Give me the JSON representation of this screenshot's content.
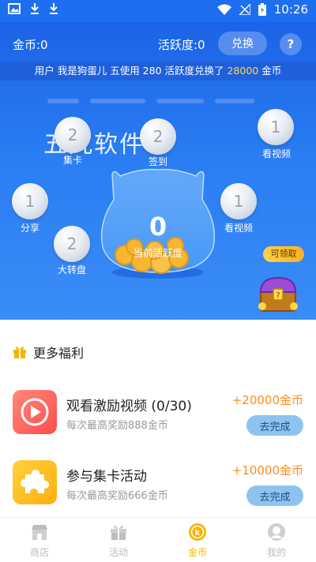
{
  "statusbar": {
    "time": "10:26"
  },
  "header": {
    "coin_label": "金币:0",
    "activity_label": "活跃度:0",
    "exchange_label": "兑换",
    "help_label": "?"
  },
  "ticker": {
    "prefix": "用户 我是狗蛋儿 五使用 280 活跃度兑换了 ",
    "amount": "28000",
    "suffix": " 金币"
  },
  "watermark": "五九软件",
  "bubbles": [
    {
      "value": "2",
      "label": "集卡"
    },
    {
      "value": "2",
      "label": "签到"
    },
    {
      "value": "1",
      "label": "看视频"
    },
    {
      "value": "1",
      "label": "分享"
    },
    {
      "value": "1",
      "label": "看视频"
    },
    {
      "value": "2",
      "label": "大转盘"
    }
  ],
  "jar": {
    "value": "0",
    "caption": "当前活跃度"
  },
  "chest": {
    "badge": "可领取"
  },
  "section": {
    "title": "更多福利"
  },
  "tasks": [
    {
      "title": "观看激励视频 (0/30)",
      "subtitle": "每次最高奖励888金币",
      "reward": "+20000金币",
      "button": "去完成",
      "icon": "video-play-icon"
    },
    {
      "title": "参与集卡活动",
      "subtitle": "每次最高奖励666金币",
      "reward": "+10000金币",
      "button": "去完成",
      "icon": "puzzle-icon"
    }
  ],
  "tabs": [
    {
      "label": "商店",
      "icon": "store-icon"
    },
    {
      "label": "活动",
      "icon": "gift-icon"
    },
    {
      "label": "金币",
      "icon": "coin-icon",
      "active": true
    },
    {
      "label": "我的",
      "icon": "profile-icon"
    }
  ],
  "colors": {
    "primary": "#1e6ff0",
    "reward": "#ff8c1a",
    "active_tab": "#f5b400",
    "button": "#8fc3ef"
  }
}
